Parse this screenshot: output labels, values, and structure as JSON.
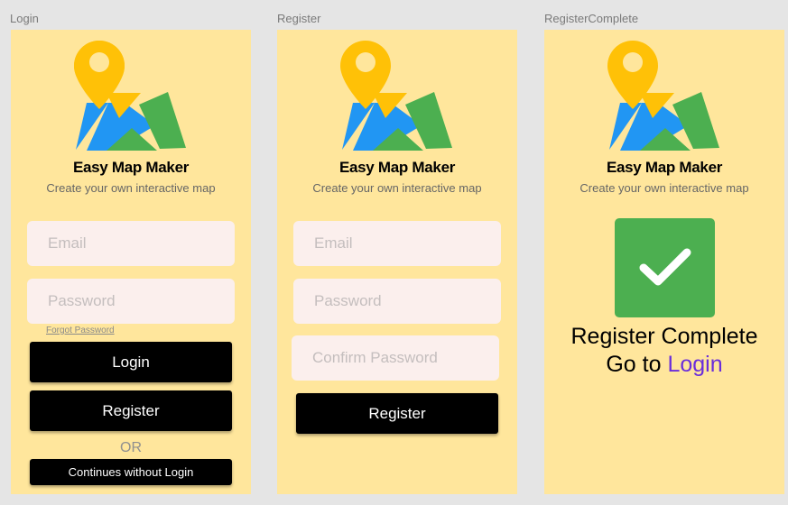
{
  "frames": {
    "login": {
      "label": "Login"
    },
    "register": {
      "label": "Register"
    },
    "complete": {
      "label": "RegisterComplete"
    }
  },
  "brand": {
    "title": "Easy Map Maker",
    "subtitle": "Create your own interactive map"
  },
  "login": {
    "email_placeholder": "Email",
    "password_placeholder": "Password",
    "forgot_password": "Forgot Password",
    "login_button": "Login",
    "register_button": "Register",
    "or_text": "OR",
    "guest_button": "Continues without Login"
  },
  "register": {
    "email_placeholder": "Email",
    "password_placeholder": "Password",
    "confirm_placeholder": "Confirm Password",
    "register_button": "Register"
  },
  "complete": {
    "message": "Register Complete",
    "go_to": "Go to",
    "login_link": "Login"
  },
  "icons": {
    "logo": "map-pin-logo-icon",
    "success": "checkmark-icon"
  },
  "colors": {
    "frame_bg": "#ffe69c",
    "pin": "#ffc107",
    "map_blue": "#2196f3",
    "map_green": "#4caf50",
    "input_bg": "#fbefed",
    "button_bg": "#000000",
    "link": "#6a2ddb"
  }
}
